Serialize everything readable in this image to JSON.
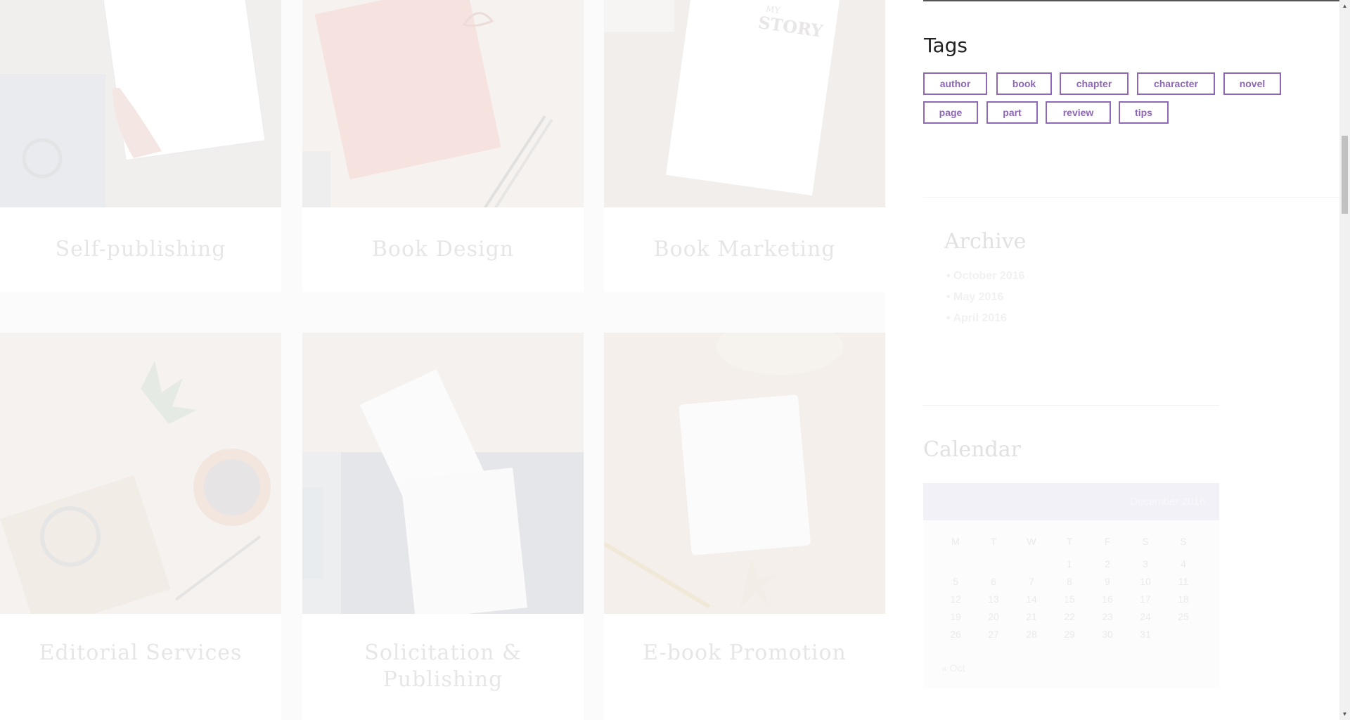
{
  "services": [
    {
      "title": "Self-publishing"
    },
    {
      "title": "Book Design"
    },
    {
      "title": "Book Marketing"
    },
    {
      "title": "Editorial Services"
    },
    {
      "title": "Solicitation & Publishing"
    },
    {
      "title": "E-book Promotion"
    }
  ],
  "book_cover_text": {
    "line1": "MY",
    "line2": "STORY"
  },
  "tags": {
    "title": "Tags",
    "items": [
      "author",
      "book",
      "chapter",
      "character",
      "novel",
      "page",
      "part",
      "review",
      "tips"
    ]
  },
  "archive": {
    "title": "Archive",
    "items": [
      "October 2016",
      "May 2016",
      "April 2016"
    ]
  },
  "calendar": {
    "title": "Calendar",
    "month": "December 2016",
    "weekdays": [
      "M",
      "T",
      "W",
      "T",
      "F",
      "S",
      "S"
    ],
    "weeks": [
      [
        "",
        "",
        "",
        "1",
        "2",
        "3",
        "4"
      ],
      [
        "5",
        "6",
        "7",
        "8",
        "9",
        "10",
        "11"
      ],
      [
        "12",
        "13",
        "14",
        "15",
        "16",
        "17",
        "18"
      ],
      [
        "19",
        "20",
        "21",
        "22",
        "23",
        "24",
        "25"
      ],
      [
        "26",
        "27",
        "28",
        "29",
        "30",
        "31",
        ""
      ]
    ],
    "prev_link": "« Oct"
  }
}
